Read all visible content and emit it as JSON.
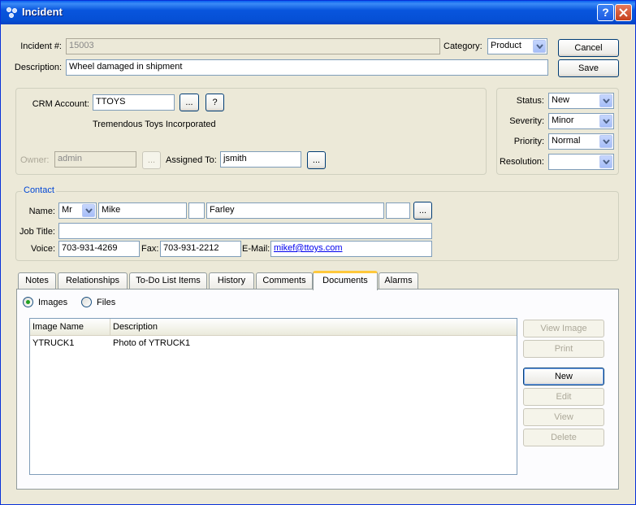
{
  "window": {
    "title": "Incident"
  },
  "header": {
    "incident_label": "Incident #:",
    "incident_number": "15003",
    "category_label": "Category:",
    "category_value": "Product",
    "description_label": "Description:",
    "description_value": "Wheel damaged in shipment",
    "cancel_label": "Cancel",
    "save_label": "Save"
  },
  "account": {
    "crm_label": "CRM Account:",
    "crm_value": "TTOYS",
    "ellipsis": "...",
    "question": "?",
    "account_name": "Tremendous Toys Incorporated",
    "owner_label": "Owner:",
    "owner_value": "admin",
    "assigned_label": "Assigned To:",
    "assigned_value": "jsmith"
  },
  "status_panel": {
    "status_label": "Status:",
    "status_value": "New",
    "severity_label": "Severity:",
    "severity_value": "Minor",
    "priority_label": "Priority:",
    "priority_value": "Normal",
    "resolution_label": "Resolution:",
    "resolution_value": ""
  },
  "contact": {
    "group_label": "Contact",
    "name_label": "Name:",
    "honorific": "Mr",
    "first_name": "Mike",
    "middle_name": "",
    "last_name": "Farley",
    "suffix": "",
    "job_title_label": "Job Title:",
    "job_title_value": "",
    "voice_label": "Voice:",
    "voice_value": "703-931-4269",
    "fax_label": "Fax:",
    "fax_value": "703-931-2212",
    "email_label": "E-Mail:",
    "email_value": "mikef@ttoys.com"
  },
  "tabs": [
    {
      "label": "Notes"
    },
    {
      "label": "Relationships"
    },
    {
      "label": "To-Do List Items"
    },
    {
      "label": "History"
    },
    {
      "label": "Comments"
    },
    {
      "label": "Documents"
    },
    {
      "label": "Alarms"
    }
  ],
  "documents": {
    "images_label": "Images",
    "files_label": "Files",
    "selected": "Images",
    "columns": [
      "Image Name",
      "Description"
    ],
    "rows": [
      {
        "name": "YTRUCK1",
        "description": "Photo of YTRUCK1"
      }
    ],
    "buttons": {
      "view_image": "View Image",
      "print": "Print",
      "new": "New",
      "edit": "Edit",
      "view": "View",
      "delete": "Delete"
    }
  },
  "colors": {
    "title_bar": "#0855dd",
    "window_bg": "#ece9d8",
    "active_tab_accent": "#ffc83c",
    "group_label": "#0046d5"
  }
}
